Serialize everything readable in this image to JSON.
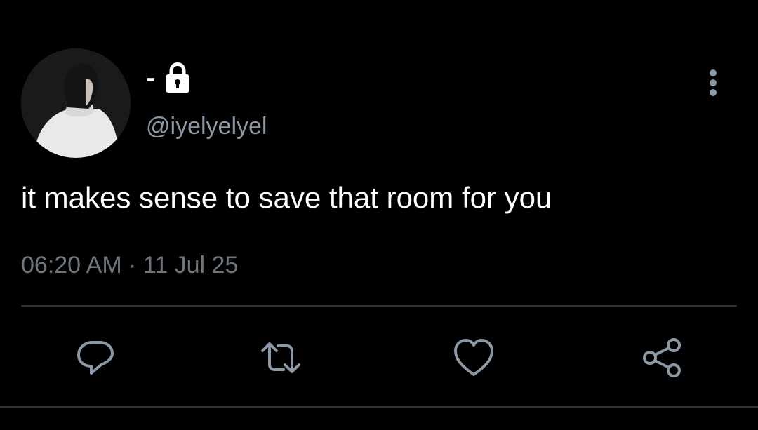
{
  "tweet": {
    "display_name": "-",
    "handle": "@iyelyelyel",
    "text": "it makes sense to save that room for you",
    "time": "06:20 AM",
    "separator": "·",
    "date": "11 Jul 25"
  },
  "icons": {
    "lock": "lock-icon",
    "more": "more-vertical-icon",
    "reply": "reply-icon",
    "retweet": "retweet-icon",
    "like": "heart-icon",
    "share": "share-icon"
  },
  "colors": {
    "background": "#000000",
    "primary_text": "#ffffff",
    "secondary_text": "#8b98a5",
    "icon": "#8b98a5",
    "divider": "#2f3336"
  }
}
